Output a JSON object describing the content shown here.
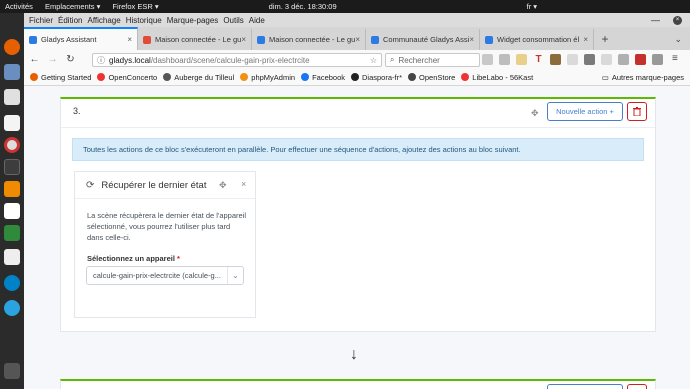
{
  "system_bar": {
    "activities": "Activités",
    "places": "Emplacements ▾",
    "app": "Firefox ESR ▾",
    "clock": "dim. 3 déc.  18:30:09",
    "lang": "fr ▾"
  },
  "menu": [
    "Fichier",
    "Édition",
    "Affichage",
    "Historique",
    "Marque-pages",
    "Outils",
    "Aide"
  ],
  "tabs": [
    {
      "label": "Gladys Assistant",
      "color": "#2c7be5",
      "active": true
    },
    {
      "label": "Maison connectée - Le gu",
      "color": "#e04b3a",
      "active": false
    },
    {
      "label": "Maison connectée - Le gu",
      "color": "#2c7be5",
      "active": false
    },
    {
      "label": "Communauté Gladys Assi",
      "color": "#2c7be5",
      "active": false
    },
    {
      "label": "Widget consommation él",
      "color": "#2c7be5",
      "active": false
    }
  ],
  "url": {
    "domain": "gladys.local",
    "path": "/dashboard/scene/calcule-gain-prix-electrcite"
  },
  "search_placeholder": "Rechercher",
  "bookmarks": [
    {
      "label": "Getting Started",
      "color": "#e66000"
    },
    {
      "label": "OpenConcerto",
      "color": "#e33"
    },
    {
      "label": "Auberge du Tilleul",
      "color": "#555"
    },
    {
      "label": "phpMyAdmin",
      "color": "#f29111"
    },
    {
      "label": "Facebook",
      "color": "#1877f2"
    },
    {
      "label": "Diaspora-fr*",
      "color": "#222"
    },
    {
      "label": "OpenStore",
      "color": "#444"
    },
    {
      "label": "LibeLabo - 56Kast",
      "color": "#e33"
    }
  ],
  "bookmarks_other": "Autres marque-pages",
  "scene": {
    "block_number": "3.",
    "new_action": "Nouvelle action +",
    "info": "Toutes les actions de ce bloc s'exécuteront en parallèle. Pour effectuer une séquence d'actions, ajoutez des actions au bloc suivant.",
    "action": {
      "title": "Récupérer le dernier état",
      "description": "La scène récupèrera le dernier état de l'appareil sélectionné, vous pourrez l'utiliser plus tard dans celle-ci.",
      "device_label": "Sélectionnez un appareil",
      "required_mark": "*",
      "device_value": "calcule-gain-prix-electrcite (calcule-g..."
    }
  }
}
